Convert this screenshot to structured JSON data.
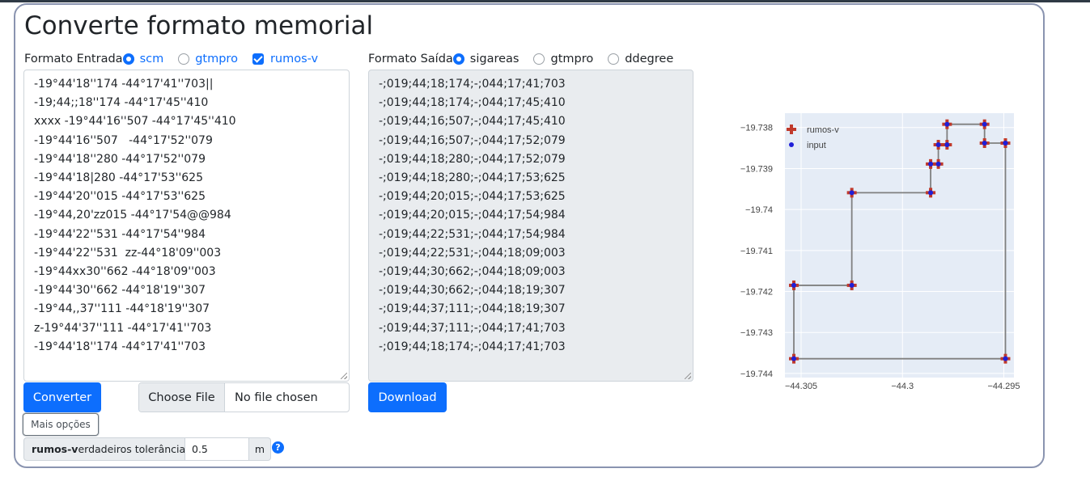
{
  "title": "Converte formato memorial",
  "input_format": {
    "label": "Formato Entrada",
    "options": [
      {
        "label": "scm",
        "kind": "radio",
        "checked": true
      },
      {
        "label": "gtmpro",
        "kind": "radio",
        "checked": false
      },
      {
        "label": "rumos-v",
        "kind": "checkbox",
        "checked": true
      }
    ]
  },
  "output_format": {
    "label": "Formato Saída",
    "options": [
      {
        "label": "sigareas",
        "kind": "radio",
        "checked": true
      },
      {
        "label": "gtmpro",
        "kind": "radio",
        "checked": false
      },
      {
        "label": "ddegree",
        "kind": "radio",
        "checked": false
      }
    ]
  },
  "input_text": [
    "-19°44'18''174 -44°17'41''703||",
    "-19;44;;18''174 -44°17'45''410",
    "xxxx -19°44'16''507 -44°17'45''410",
    "-19°44'16''507   -44°17'52''079",
    "-19°44'18''280 -44°17'52''079",
    "-19°44'18|280 -44°17'53''625",
    "-19°44'20''015 -44°17'53''625",
    "-19°44,20'zz015 -44°17'54@@984",
    "-19°44'22''531 -44°17'54''984",
    "-19°44'22''531  zz-44°18'09''003",
    "-19°44xx30''662 -44°18'09''003",
    "-19°44'30''662 -44°18'19''307",
    "-19°44,,37''111 -44°18'19''307",
    "z-19°44'37''111 -44°17'41''703",
    "-19°44'18''174 -44°17'41''703"
  ],
  "output_text": [
    "-;019;44;18;174;-;044;17;41;703",
    "-;019;44;18;174;-;044;17;45;410",
    "-;019;44;16;507;-;044;17;45;410",
    "-;019;44;16;507;-;044;17;52;079",
    "-;019;44;18;280;-;044;17;52;079",
    "-;019;44;18;280;-;044;17;53;625",
    "-;019;44;20;015;-;044;17;53;625",
    "-;019;44;20;015;-;044;17;54;984",
    "-;019;44;22;531;-;044;17;54;984",
    "-;019;44;22;531;-;044;18;09;003",
    "-;019;44;30;662;-;044;18;09;003",
    "-;019;44;30;662;-;044;18;19;307",
    "-;019;44;37;111;-;044;18;19;307",
    "-;019;44;37;111;-;044;17;41;703",
    "-;019;44;18;174;-;044;17;41;703"
  ],
  "buttons": {
    "convert": "Converter",
    "choose_file": "Choose File",
    "file_status": "No file chosen",
    "download": "Download",
    "more_options": "Mais opções"
  },
  "tolerance": {
    "label_bold": "rumos-v",
    "label_rest": "erdadeiros tolerância",
    "value": "0.5",
    "unit": "m",
    "help": "?"
  },
  "colors": {
    "accent": "#0d6efd",
    "plot_bg": "#e5ecf6",
    "rumos_marker": "#c0392b",
    "input_marker": "#1f1fd8",
    "path_line": "#808080"
  },
  "chart_data": {
    "type": "scatter",
    "title": "",
    "xlabel": "",
    "ylabel": "",
    "xlim": [
      -44.3058,
      -44.2945
    ],
    "ylim": [
      -19.7441,
      -19.73765
    ],
    "xticks": [
      -44.305,
      -44.3,
      -44.295
    ],
    "xtick_labels": [
      "−44.305",
      "−44.3",
      "−44.295"
    ],
    "yticks": [
      -19.738,
      -19.739,
      -19.74,
      -19.741,
      -19.742,
      -19.743,
      -19.744
    ],
    "ytick_labels": [
      "−19.738",
      "−19.739",
      "−19.74",
      "−19.741",
      "−19.742",
      "−19.743",
      "−19.744"
    ],
    "grid": true,
    "legend": "top-left",
    "series": [
      {
        "name": "rumos-v",
        "marker": "cross",
        "x": [
          -44.29492,
          -44.29595,
          -44.29595,
          -44.2978,
          -44.2978,
          -44.29823,
          -44.29823,
          -44.29861,
          -44.29861,
          -44.3025,
          -44.3025,
          -44.30536,
          -44.30536,
          -44.29492,
          -44.29492
        ],
        "y": [
          -19.73838,
          -19.73838,
          -19.73792,
          -19.73792,
          -19.73842,
          -19.73842,
          -19.73889,
          -19.73889,
          -19.73959,
          -19.73959,
          -19.74185,
          -19.74185,
          -19.74364,
          -19.74364,
          -19.73838
        ]
      },
      {
        "name": "input",
        "marker": "dot",
        "x": [
          -44.29492,
          -44.29595,
          -44.29595,
          -44.2978,
          -44.2978,
          -44.29823,
          -44.29823,
          -44.29861,
          -44.29861,
          -44.3025,
          -44.3025,
          -44.30536,
          -44.30536,
          -44.29492,
          -44.29492
        ],
        "y": [
          -19.73838,
          -19.73838,
          -19.73792,
          -19.73792,
          -19.73842,
          -19.73842,
          -19.73889,
          -19.73889,
          -19.73959,
          -19.73959,
          -19.74185,
          -19.74185,
          -19.74364,
          -19.74364,
          -19.73838
        ]
      }
    ]
  }
}
